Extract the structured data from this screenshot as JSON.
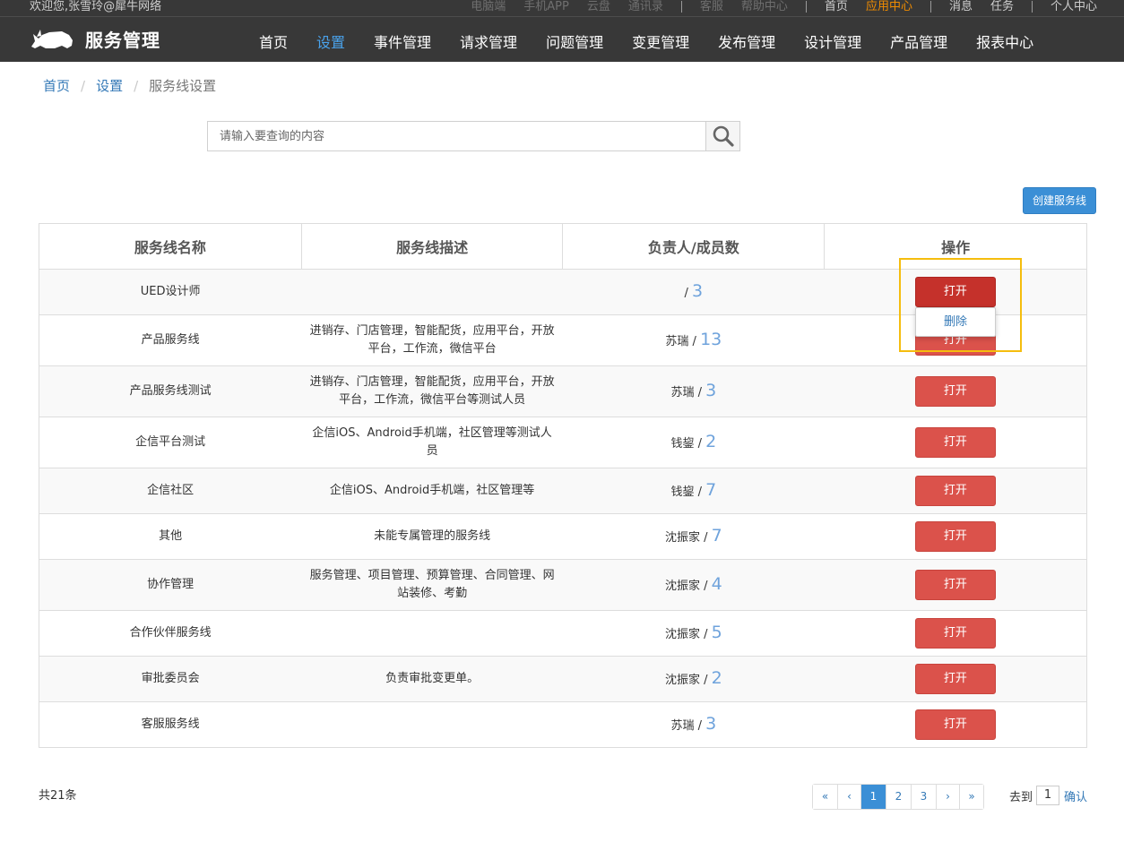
{
  "header": {
    "welcome": "欢迎您,张雪玲@犀牛网络",
    "top_links_group1": [
      "电脑端",
      "手机APP",
      "云盘",
      "通讯录"
    ],
    "top_links_group2": [
      "客服",
      "帮助中心"
    ],
    "top_links_group3": [
      "首页",
      "应用中心"
    ],
    "top_links_group4": [
      "消息",
      "任务"
    ],
    "top_links_group5": [
      "个人中心"
    ],
    "app_title": "服务管理",
    "nav": [
      "首页",
      "设置",
      "事件管理",
      "请求管理",
      "问题管理",
      "变更管理",
      "发布管理",
      "设计管理",
      "产品管理",
      "报表中心"
    ]
  },
  "breadcrumb": [
    "首页",
    "设置",
    "服务线设置"
  ],
  "breadcrumb_sep": "/",
  "search": {
    "placeholder": "请输入要查询的内容"
  },
  "create_button": "创建服务线",
  "table": {
    "columns": [
      "服务线名称",
      "服务线描述",
      "负责人/成员数",
      "操作"
    ],
    "rows": [
      {
        "name": "UED设计师",
        "desc": "",
        "lead": "",
        "count": "3"
      },
      {
        "name": "产品服务线",
        "desc": "进销存、门店管理，智能配货，应用平台，开放平台，工作流，微信平台",
        "lead": "苏瑞",
        "count": "13"
      },
      {
        "name": "产品服务线测试",
        "desc": "进销存、门店管理，智能配货，应用平台，开放平台，工作流，微信平台等测试人员",
        "lead": "苏瑞",
        "count": "3"
      },
      {
        "name": "企信平台测试",
        "desc": "企信iOS、Android手机端，社区管理等测试人员",
        "lead": "钱鋆",
        "count": "2"
      },
      {
        "name": "企信社区",
        "desc": "企信iOS、Android手机端，社区管理等",
        "lead": "钱鋆",
        "count": "7"
      },
      {
        "name": "其他",
        "desc": "未能专属管理的服务线",
        "lead": "沈振家",
        "count": "7"
      },
      {
        "name": "协作管理",
        "desc": "服务管理、项目管理、预算管理、合同管理、网站装修、考勤",
        "lead": "沈振家",
        "count": "4"
      },
      {
        "name": "合作伙伴服务线",
        "desc": "",
        "lead": "沈振家",
        "count": "5"
      },
      {
        "name": "审批委员会",
        "desc": "负责审批变更单。",
        "lead": "沈振家",
        "count": "2"
      },
      {
        "name": "客服服务线",
        "desc": "",
        "lead": "苏瑞",
        "count": "3"
      }
    ],
    "open_label": "打开",
    "count_sep": "/"
  },
  "dropdown": {
    "delete_label": "删除"
  },
  "footer": {
    "total": "共21条",
    "pager": [
      "«",
      "‹",
      "1",
      "2",
      "3",
      "›",
      "»"
    ],
    "active_page": "1",
    "goto_label": "去到",
    "goto_value": "1",
    "confirm_label": "确认"
  },
  "colors": {
    "open_button": "#db524b",
    "accent": "#3b8fd6",
    "nav_active": "#4aa3ec",
    "highlight": "#f5bd0e",
    "top_orange": "#f08c00"
  },
  "icons": {
    "logo": "rhino-logo-icon",
    "search": "search-icon"
  }
}
